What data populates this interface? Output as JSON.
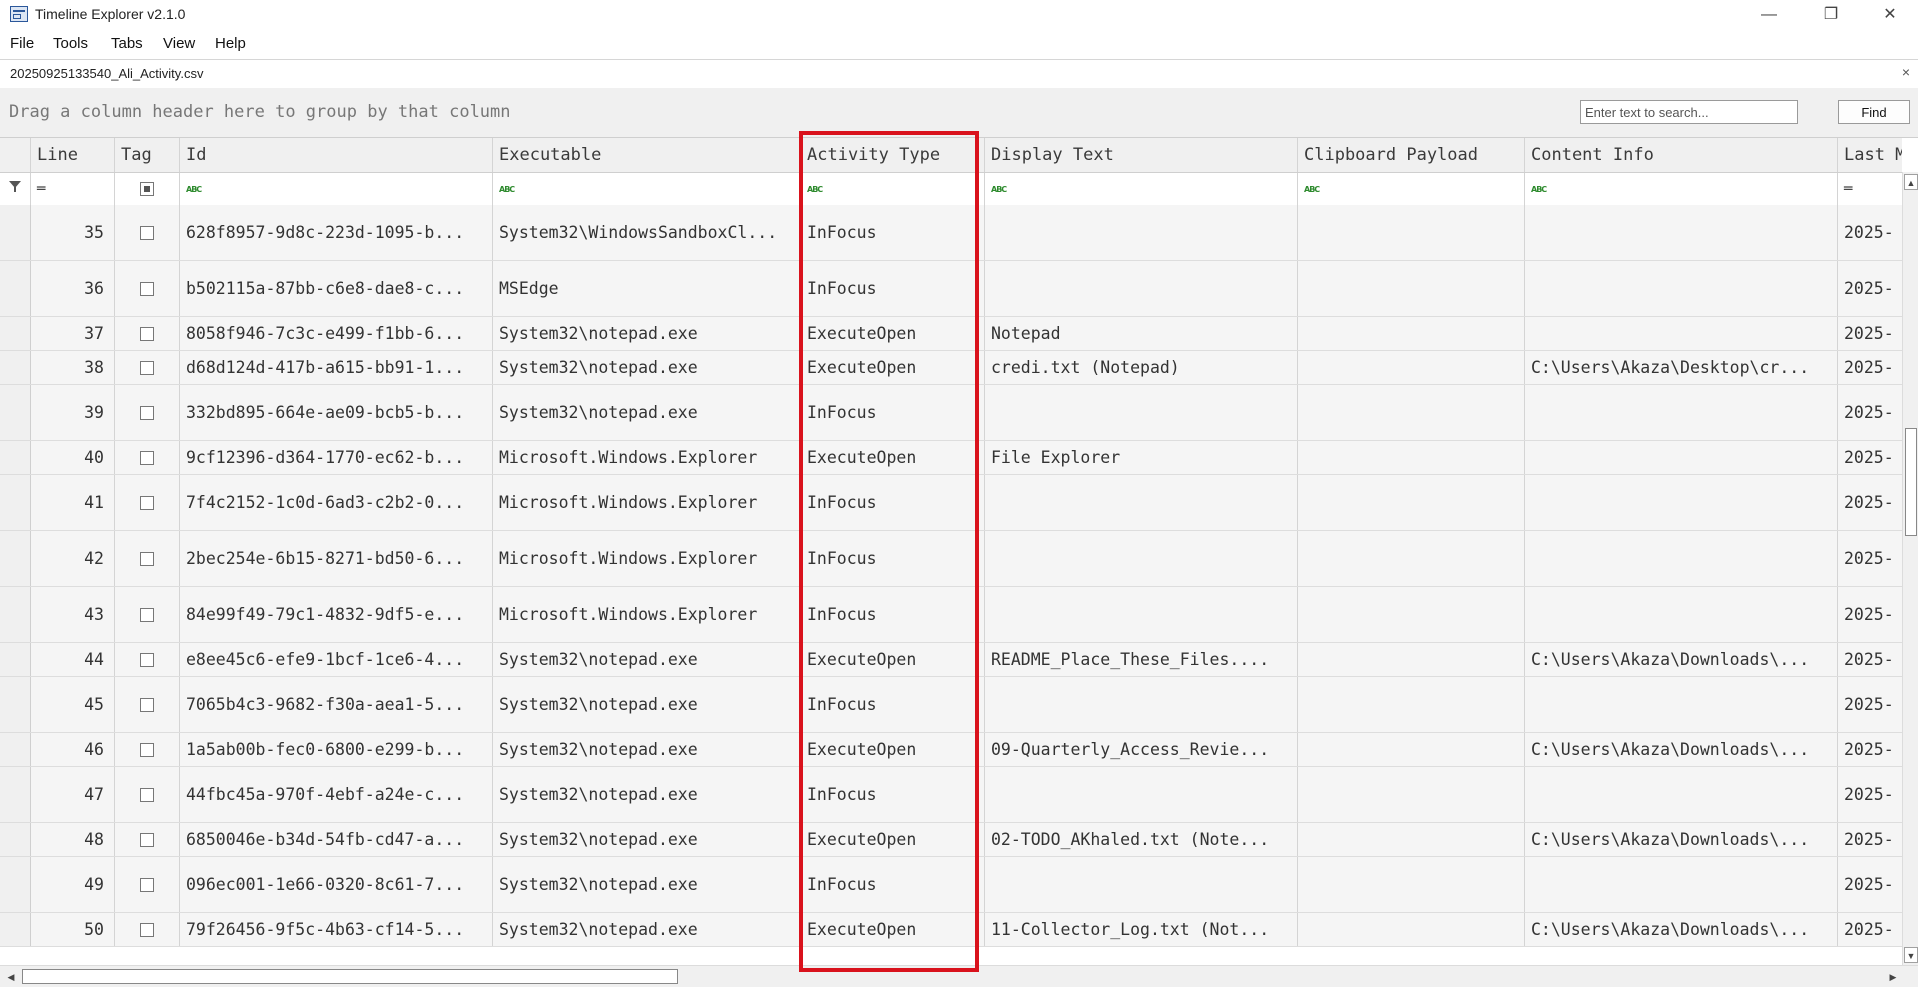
{
  "window": {
    "title": "Timeline Explorer v2.1.0",
    "minimize_glyph": "—",
    "restore_glyph": "❐",
    "close_glyph": "✕"
  },
  "menu": [
    "File",
    "Tools",
    "Tabs",
    "View",
    "Help"
  ],
  "file_tab": {
    "name": "20250925133540_Ali_Activity.csv",
    "close_glyph": "×"
  },
  "group_panel": {
    "hint": "Drag a column header here to group by that column"
  },
  "search": {
    "placeholder": "Enter text to search...",
    "value": "",
    "find_label": "Find"
  },
  "columns": [
    {
      "key": "line",
      "label": "Line",
      "filter": "equals-icon"
    },
    {
      "key": "tag",
      "label": "Tag",
      "filter": "checkbox-icon"
    },
    {
      "key": "id",
      "label": "Id",
      "filter": "abc-icon"
    },
    {
      "key": "executable",
      "label": "Executable",
      "filter": "abc-icon"
    },
    {
      "key": "activity_type",
      "label": "Activity Type",
      "filter": "abc-icon"
    },
    {
      "key": "display_text",
      "label": "Display Text",
      "filter": "abc-icon"
    },
    {
      "key": "clipboard_payload",
      "label": "Clipboard Payload",
      "filter": "abc-icon"
    },
    {
      "key": "content_info",
      "label": "Content Info",
      "filter": "abc-icon"
    },
    {
      "key": "last_modified",
      "label": "Last Mo",
      "filter": "equals-icon"
    }
  ],
  "filter_glyphs": {
    "equals": "═",
    "abc": "ABC"
  },
  "rows": [
    {
      "line": "35",
      "id": "628f8957-9d8c-223d-1095-b...",
      "executable": "System32\\WindowsSandboxCl...",
      "activity_type": "InFocus",
      "display_text": "",
      "clipboard_payload": "",
      "content_info": "",
      "last_modified": "2025-",
      "tall": true
    },
    {
      "line": "36",
      "id": "b502115a-87bb-c6e8-dae8-c...",
      "executable": "MSEdge",
      "activity_type": "InFocus",
      "display_text": "",
      "clipboard_payload": "",
      "content_info": "",
      "last_modified": "2025-",
      "tall": true
    },
    {
      "line": "37",
      "id": "8058f946-7c3c-e499-f1bb-6...",
      "executable": "System32\\notepad.exe",
      "activity_type": "ExecuteOpen",
      "display_text": "Notepad",
      "clipboard_payload": "",
      "content_info": "",
      "last_modified": "2025-",
      "tall": false
    },
    {
      "line": "38",
      "id": "d68d124d-417b-a615-bb91-1...",
      "executable": "System32\\notepad.exe",
      "activity_type": "ExecuteOpen",
      "display_text": "credi.txt (Notepad)",
      "clipboard_payload": "",
      "content_info": "C:\\Users\\Akaza\\Desktop\\cr...",
      "last_modified": "2025-",
      "tall": false
    },
    {
      "line": "39",
      "id": "332bd895-664e-ae09-bcb5-b...",
      "executable": "System32\\notepad.exe",
      "activity_type": "InFocus",
      "display_text": "",
      "clipboard_payload": "",
      "content_info": "",
      "last_modified": "2025-",
      "tall": true
    },
    {
      "line": "40",
      "id": "9cf12396-d364-1770-ec62-b...",
      "executable": "Microsoft.Windows.Explorer",
      "activity_type": "ExecuteOpen",
      "display_text": "File Explorer",
      "clipboard_payload": "",
      "content_info": "",
      "last_modified": "2025-",
      "tall": false
    },
    {
      "line": "41",
      "id": "7f4c2152-1c0d-6ad3-c2b2-0...",
      "executable": "Microsoft.Windows.Explorer",
      "activity_type": "InFocus",
      "display_text": "",
      "clipboard_payload": "",
      "content_info": "",
      "last_modified": "2025-",
      "tall": true
    },
    {
      "line": "42",
      "id": "2bec254e-6b15-8271-bd50-6...",
      "executable": "Microsoft.Windows.Explorer",
      "activity_type": "InFocus",
      "display_text": "",
      "clipboard_payload": "",
      "content_info": "",
      "last_modified": "2025-",
      "tall": true
    },
    {
      "line": "43",
      "id": "84e99f49-79c1-4832-9df5-e...",
      "executable": "Microsoft.Windows.Explorer",
      "activity_type": "InFocus",
      "display_text": "",
      "clipboard_payload": "",
      "content_info": "",
      "last_modified": "2025-",
      "tall": true
    },
    {
      "line": "44",
      "id": "e8ee45c6-efe9-1bcf-1ce6-4...",
      "executable": "System32\\notepad.exe",
      "activity_type": "ExecuteOpen",
      "display_text": "README_Place_These_Files....",
      "clipboard_payload": "",
      "content_info": "C:\\Users\\Akaza\\Downloads\\...",
      "last_modified": "2025-",
      "tall": false
    },
    {
      "line": "45",
      "id": "7065b4c3-9682-f30a-aea1-5...",
      "executable": "System32\\notepad.exe",
      "activity_type": "InFocus",
      "display_text": "",
      "clipboard_payload": "",
      "content_info": "",
      "last_modified": "2025-",
      "tall": true
    },
    {
      "line": "46",
      "id": "1a5ab00b-fec0-6800-e299-b...",
      "executable": "System32\\notepad.exe",
      "activity_type": "ExecuteOpen",
      "display_text": "09-Quarterly_Access_Revie...",
      "clipboard_payload": "",
      "content_info": "C:\\Users\\Akaza\\Downloads\\...",
      "last_modified": "2025-",
      "tall": false
    },
    {
      "line": "47",
      "id": "44fbc45a-970f-4ebf-a24e-c...",
      "executable": "System32\\notepad.exe",
      "activity_type": "InFocus",
      "display_text": "",
      "clipboard_payload": "",
      "content_info": "",
      "last_modified": "2025-",
      "tall": true
    },
    {
      "line": "48",
      "id": "6850046e-b34d-54fb-cd47-a...",
      "executable": "System32\\notepad.exe",
      "activity_type": "ExecuteOpen",
      "display_text": "02-TODO_AKhaled.txt (Note...",
      "clipboard_payload": "",
      "content_info": "C:\\Users\\Akaza\\Downloads\\...",
      "last_modified": "2025-",
      "tall": false
    },
    {
      "line": "49",
      "id": "096ec001-1e66-0320-8c61-7...",
      "executable": "System32\\notepad.exe",
      "activity_type": "InFocus",
      "display_text": "",
      "clipboard_payload": "",
      "content_info": "",
      "last_modified": "2025-",
      "tall": true
    },
    {
      "line": "50",
      "id": "79f26456-9f5c-4b63-cf14-5...",
      "executable": "System32\\notepad.exe",
      "activity_type": "ExecuteOpen",
      "display_text": "11-Collector_Log.txt (Not...",
      "clipboard_payload": "",
      "content_info": "C:\\Users\\Akaza\\Downloads\\...",
      "last_modified": "2025-",
      "tall": false
    }
  ],
  "scrollbar": {
    "up_glyph": "▲",
    "down_glyph": "▼",
    "left_glyph": "◀",
    "right_glyph": "▶"
  },
  "colors": {
    "highlight": "#d9121c",
    "abc_icon": "#2d8a2d",
    "row_background": "#f5f5f5"
  }
}
